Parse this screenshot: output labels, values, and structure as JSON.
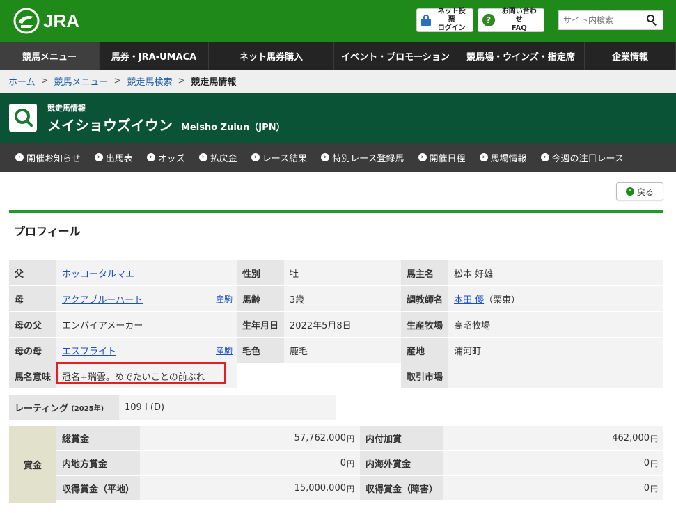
{
  "header": {
    "logo_text": "JRA",
    "login_line1": "ネット投票",
    "login_line2": "ログイン",
    "faq_line1": "お問い合わせ",
    "faq_line2": "FAQ",
    "search_placeholder": "サイト内検索"
  },
  "main_nav": [
    {
      "label": "競馬メニュー",
      "active": true
    },
    {
      "label": "馬券・JRA-UMACA"
    },
    {
      "label": "ネット馬券購入"
    },
    {
      "label": "イベント・プロモーション"
    },
    {
      "label": "競馬場・ウインズ・指定席"
    },
    {
      "label": "企業情報"
    }
  ],
  "breadcrumb": {
    "items": [
      "ホーム",
      "競馬メニュー",
      "競走馬検索"
    ],
    "current": "競走馬情報"
  },
  "title": {
    "subtitle": "競走馬情報",
    "name_jp": "メイショウズイウン",
    "name_en": "Meisho Zuiun（JPN）"
  },
  "sub_nav": [
    "開催お知らせ",
    "出馬表",
    "オッズ",
    "払戻金",
    "レース結果",
    "特別レース登録馬",
    "開催日程",
    "馬場情報",
    "今週の注目レース"
  ],
  "back_label": "戻る",
  "profile": {
    "heading": "プロフィール",
    "sire_label": "父",
    "sire": "ホッコータルマエ",
    "sex_label": "性別",
    "sex": "牡",
    "owner_label": "馬主名",
    "owner": "松本 好雄",
    "dam_label": "母",
    "dam": "アクアブルーハート",
    "dam_progeny": "産駒",
    "age_label": "馬齢",
    "age": "3歳",
    "trainer_label": "調教師名",
    "trainer": "本田 優",
    "trainer_area": "（栗東）",
    "damsire_label": "母の父",
    "damsire": "エンパイアメーカー",
    "birth_label": "生年月日",
    "birth": "2022年5月8日",
    "breeder_label": "生産牧場",
    "breeder": "高昭牧場",
    "granddam_label": "母の母",
    "granddam": "エスフライト",
    "granddam_progeny": "産駒",
    "color_label": "毛色",
    "color": "鹿毛",
    "origin_label": "産地",
    "origin": "浦河町",
    "meaning_label": "馬名意味",
    "meaning": "冠名+瑞雲。めでたいことの前ぶれ",
    "market_label": "取引市場",
    "market": ""
  },
  "rating": {
    "label": "レーティング",
    "year": "(2025年)",
    "value": "109 I (D)"
  },
  "prize": {
    "label": "賞金",
    "total_label": "総賞金",
    "total": "57,762,000",
    "added_label": "内付加賞",
    "added": "462,000",
    "local_label": "内地方賞金",
    "local": "0",
    "overseas_label": "内海外賞金",
    "overseas": "0",
    "flat_label": "収得賞金（平地）",
    "flat": "15,000,000",
    "jump_label": "収得賞金（障害）",
    "jump": "0",
    "unit": "円"
  },
  "colors": {
    "header_green": "#1f8a1a",
    "title_green": "#0b5336",
    "nav_dark": "#242424",
    "highlight_red": "#e41f1f"
  }
}
